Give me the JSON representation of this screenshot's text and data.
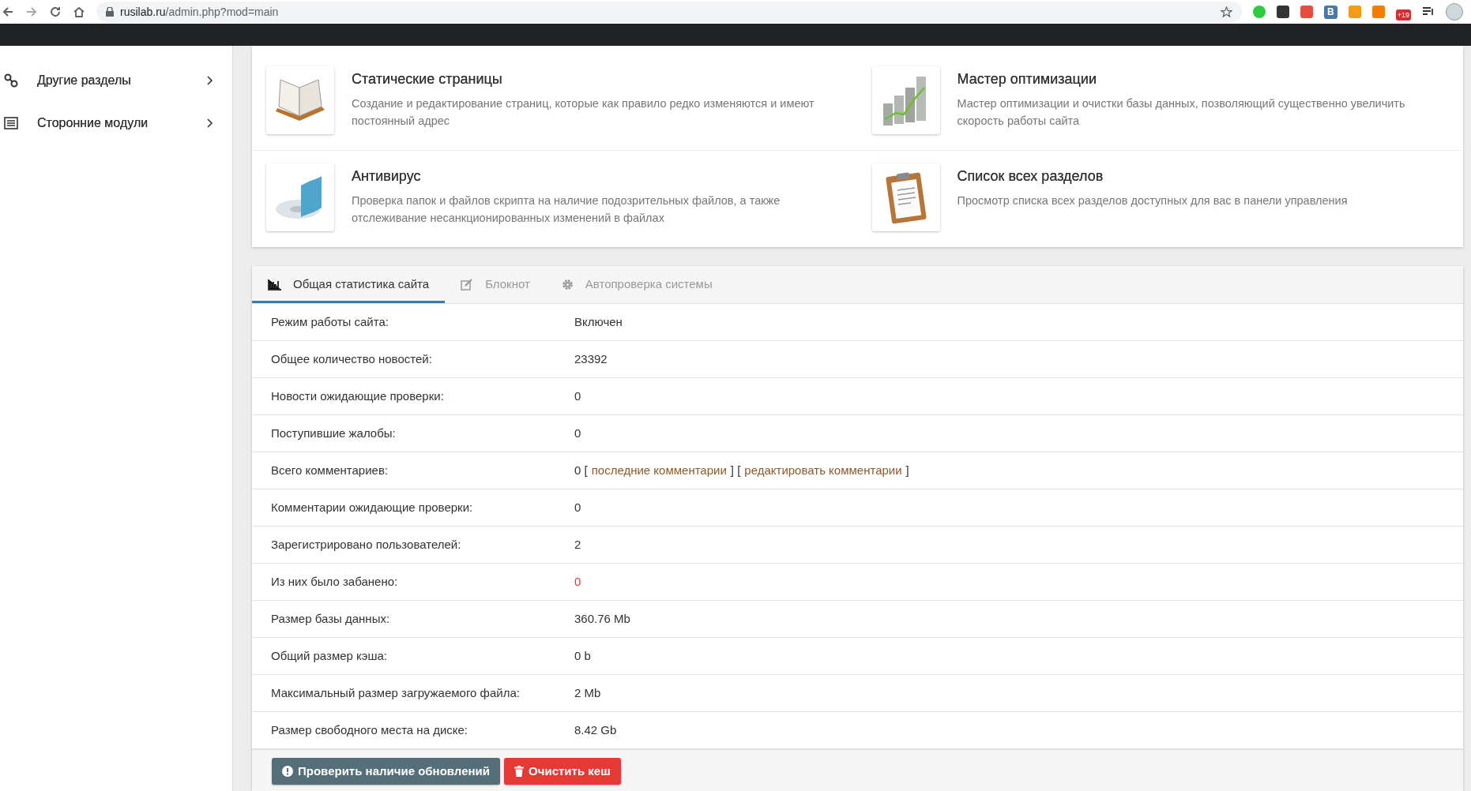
{
  "browser": {
    "url_host": "rusilab.ru",
    "url_path": "/admin.php?mod=main",
    "extensions": [
      {
        "kind": "green"
      },
      {
        "kind": "dark"
      },
      {
        "kind": "red"
      },
      {
        "kind": "letter",
        "text": "В"
      },
      {
        "kind": "rss"
      },
      {
        "kind": "orange"
      },
      {
        "kind": "badge",
        "text": "+19"
      }
    ]
  },
  "sidebar": {
    "items": [
      {
        "label": "Другие разделы",
        "kind": "link"
      },
      {
        "label": "Сторонние модули",
        "kind": "list"
      }
    ]
  },
  "cards": [
    {
      "title": "Статические страницы",
      "description": "Создание и редактирование страниц, которые как правило редко изменяются и имеют постоянный адрес",
      "kind": "book"
    },
    {
      "title": "Мастер оптимизации",
      "description": "Мастер оптимизации и очистки базы данных, позволяющий существенно увеличить скорость работы сайта",
      "kind": "chart"
    },
    {
      "title": "Антивирус",
      "description": "Проверка папок и файлов скрипта на наличие подозрительных файлов, а также отслеживание несанкционированных изменений в файлах",
      "kind": "shield"
    },
    {
      "title": "Список всех разделов",
      "description": "Просмотр списка всех разделов доступных для вас в панели управления",
      "kind": "clipboard"
    }
  ],
  "tabs": [
    {
      "label": "Общая статистика сайта",
      "kind": "chart",
      "selected": true
    },
    {
      "label": "Блокнот",
      "kind": "edit",
      "selected": false
    },
    {
      "label": "Автопроверка системы",
      "kind": "gear",
      "selected": false
    }
  ],
  "rows": [
    {
      "label": "Режим работы сайта:",
      "value": [
        {
          "text": "Включен"
        }
      ]
    },
    {
      "label": "Общее количество новостей:",
      "value": [
        {
          "text": "23392"
        }
      ]
    },
    {
      "label": "Новости ожидающие проверки:",
      "value": [
        {
          "text": "0"
        }
      ]
    },
    {
      "label": "Поступившие жалобы:",
      "value": [
        {
          "text": "0"
        }
      ]
    },
    {
      "label": "Всего комментариев:",
      "value": [
        {
          "text": "0 ["
        },
        {
          "text": "последние комментарии",
          "link": true
        },
        {
          "text": "] ["
        },
        {
          "text": "редактировать комментарии",
          "link": true
        },
        {
          "text": "]"
        }
      ]
    },
    {
      "label": "Комментарии ожидающие проверки:",
      "value": [
        {
          "text": "0"
        }
      ]
    },
    {
      "label": "Зарегистрировано пользователей:",
      "value": [
        {
          "text": "2"
        }
      ]
    },
    {
      "label": "Из них было забанено:",
      "value": [
        {
          "text": "0",
          "alert": true
        }
      ]
    },
    {
      "label": "Размер базы данных:",
      "value": [
        {
          "text": "360.76 Mb"
        }
      ]
    },
    {
      "label": "Общий размер кэша:",
      "value": [
        {
          "text": "0 b"
        }
      ]
    },
    {
      "label": "Максимальный размер загружаемого файла:",
      "value": [
        {
          "text": "2 Mb"
        }
      ]
    },
    {
      "label": "Размер свободного места на диске:",
      "value": [
        {
          "text": "8.42 Gb"
        }
      ]
    }
  ],
  "buttons": [
    {
      "label": "Проверить наличие обновлений",
      "kind": "info"
    },
    {
      "label": "Очистить кеш",
      "kind": "danger"
    }
  ]
}
